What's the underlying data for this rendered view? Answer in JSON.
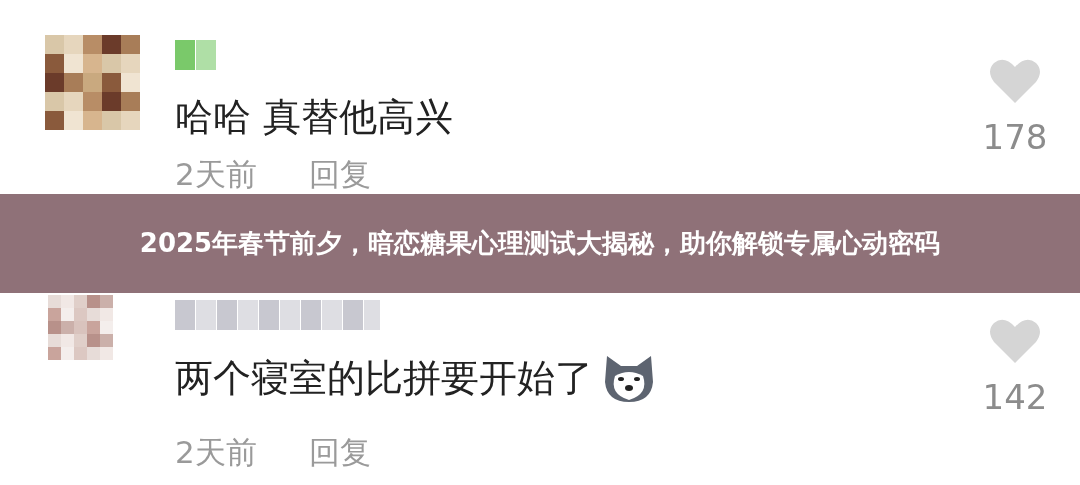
{
  "comments": [
    {
      "text": "哈哈 真替他高兴",
      "time": "2天前",
      "reply": "回复",
      "likes": "178",
      "emoji": false
    },
    {
      "text": "两个寝室的比拼要开始了",
      "time": "2天前",
      "reply": "回复",
      "likes": "142",
      "emoji": true
    }
  ],
  "banner": {
    "title": "2025年春节前夕，暗恋糖果心理测试大揭秘，助你解锁专属心动密码"
  }
}
